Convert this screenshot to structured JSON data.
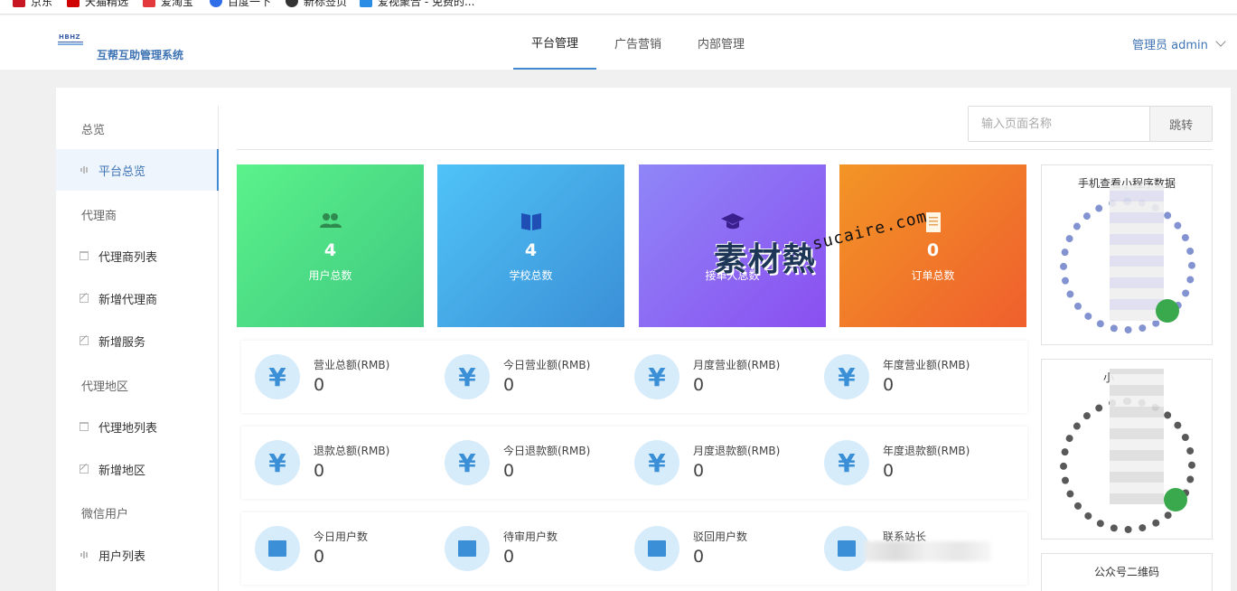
{
  "bookmarks": [
    "京东",
    "天猫精选",
    "爱淘宝",
    "百度一下",
    "新标签页",
    "爱视聚合 - 免费的..."
  ],
  "header": {
    "logo_mark": "HBHZ",
    "app_title": "互帮互助管理系统",
    "tabs": [
      {
        "label": "平台管理",
        "active": true
      },
      {
        "label": "广告营销",
        "active": false
      },
      {
        "label": "内部管理",
        "active": false
      }
    ],
    "user_label": "管理员 admin"
  },
  "sidebar": {
    "groups": [
      {
        "label": "总览",
        "items": [
          {
            "label": "平台总览",
            "icon": "bar-chart-icon",
            "active": true
          }
        ]
      },
      {
        "label": "代理商",
        "items": [
          {
            "label": "代理商列表",
            "icon": "calendar-icon"
          },
          {
            "label": "新增代理商",
            "icon": "edit-icon"
          },
          {
            "label": "新增服务",
            "icon": "edit-icon"
          }
        ]
      },
      {
        "label": "代理地区",
        "items": [
          {
            "label": "代理地列表",
            "icon": "calendar-icon"
          },
          {
            "label": "新增地区",
            "icon": "edit-icon"
          }
        ]
      },
      {
        "label": "微信用户",
        "items": [
          {
            "label": "用户列表",
            "icon": "bar-chart-icon"
          }
        ]
      }
    ]
  },
  "search": {
    "placeholder": "输入页面名称",
    "button": "跳转"
  },
  "cards": [
    {
      "value": "4",
      "label": "用户总数",
      "icon": "users-icon"
    },
    {
      "value": "4",
      "label": "学校总数",
      "icon": "book-icon"
    },
    {
      "value": "",
      "label": "接单人总数",
      "icon": "graduation-cap-icon"
    },
    {
      "value": "0",
      "label": "订单总数",
      "icon": "document-icon"
    }
  ],
  "revenue_row": [
    {
      "label": "营业总额(RMB)",
      "value": "0"
    },
    {
      "label": "今日营业额(RMB)",
      "value": "0"
    },
    {
      "label": "月度营业额(RMB)",
      "value": "0"
    },
    {
      "label": "年度营业额(RMB)",
      "value": "0"
    }
  ],
  "refund_row": [
    {
      "label": "退款总额(RMB)",
      "value": "0"
    },
    {
      "label": "今日退款额(RMB)",
      "value": "0"
    },
    {
      "label": "月度退款额(RMB)",
      "value": "0"
    },
    {
      "label": "年度退款额(RMB)",
      "value": "0"
    }
  ],
  "user_row": [
    {
      "label": "今日用户数",
      "value": "0"
    },
    {
      "label": "待审用户数",
      "value": "0"
    },
    {
      "label": "驳回用户数",
      "value": "0"
    },
    {
      "label": "联系站长",
      "value": ""
    }
  ],
  "yuan_symbol": "¥",
  "qr_cards": [
    {
      "title": "手机查看小程序数据"
    },
    {
      "title": "小"
    },
    {
      "title": "公众号二维码"
    }
  ],
  "watermark": {
    "text": "素材熱",
    "domain": "sucaire.com"
  },
  "colors": {
    "accent": "#3f8ad1",
    "card_green": "#4cd985",
    "card_blue": "#45a9e8",
    "card_purple": "#8b6cf3",
    "card_orange": "#f07a2a"
  }
}
